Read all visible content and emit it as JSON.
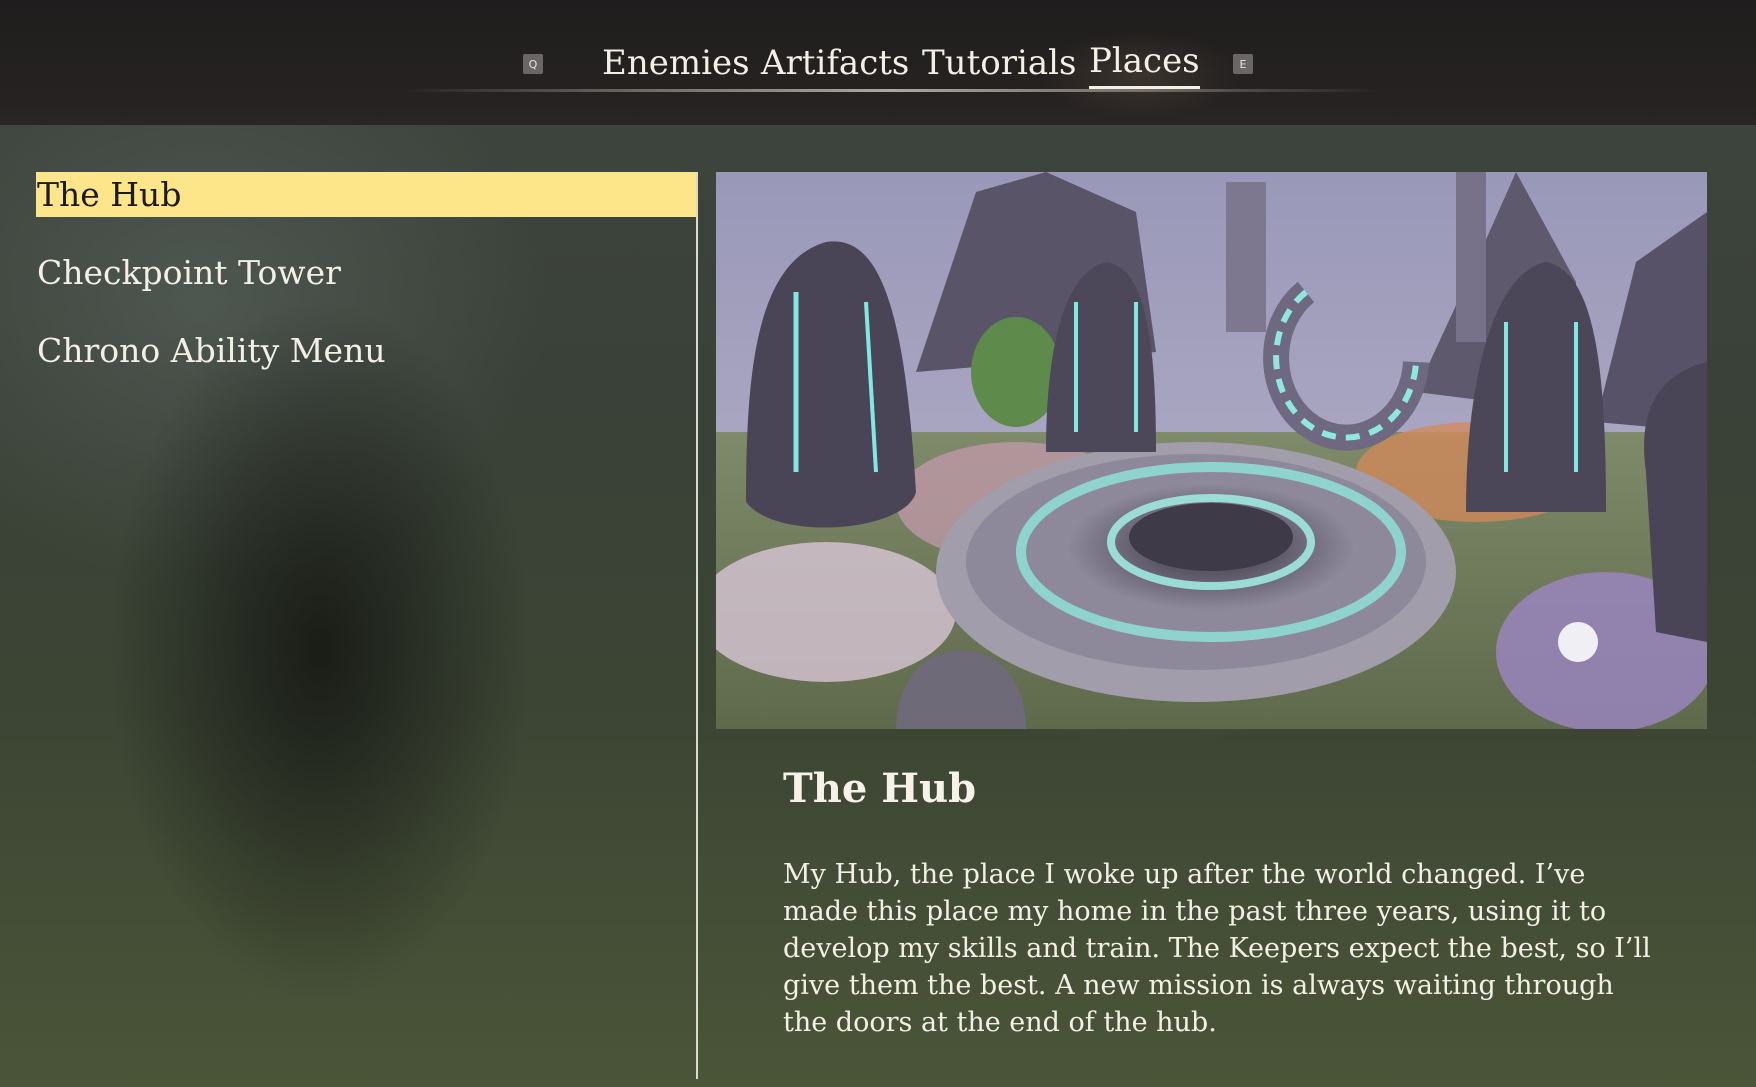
{
  "header": {
    "left_key": "Q",
    "right_key": "E",
    "tabs": [
      {
        "label": "Enemies",
        "active": false
      },
      {
        "label": "Artifacts",
        "active": false
      },
      {
        "label": "Tutorials",
        "active": false
      },
      {
        "label": "Places",
        "active": true
      }
    ]
  },
  "places": {
    "items": [
      {
        "label": "The Hub",
        "selected": true
      },
      {
        "label": "Checkpoint Tower",
        "selected": false
      },
      {
        "label": "Chrono Ability Menu",
        "selected": false
      }
    ]
  },
  "detail": {
    "title": "The Hub",
    "description": "My Hub, the place I woke up after the world changed. I’ve made this place my home in the past three years, using it to develop my skills and train. The Keepers expect the best, so I’ll give them the best. A new mission is always waiting through the doors at the end of the hub."
  },
  "colors": {
    "selection": "#fde58a",
    "text": "#f3efe6",
    "accent_glow": "#7fe8e0"
  }
}
